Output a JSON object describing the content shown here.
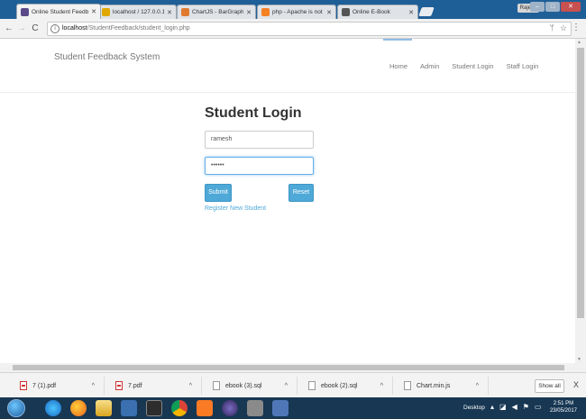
{
  "browser": {
    "tabs": [
      {
        "title": "Online Student Feedbac",
        "favicon_color": "#5b4a8a",
        "active": true
      },
      {
        "title": "localhost / 127.0.0.1 / fe",
        "favicon_color": "#e0a800",
        "active": false
      },
      {
        "title": "ChartJS - BarGraph",
        "favicon_color": "#e07a2e",
        "active": false
      },
      {
        "title": "php - Apache is not runn",
        "favicon_color": "#f48024",
        "active": false
      },
      {
        "title": "Online E-Book",
        "favicon_color": "#555555",
        "active": false
      }
    ],
    "user_badge": "Rajesh",
    "address": {
      "host": "localhost",
      "path": "/StudentFeedback/student_login.php"
    }
  },
  "site": {
    "brand": "Student Feedback System",
    "nav": [
      "Home",
      "Admin",
      "Student Login",
      "Staff Login"
    ]
  },
  "login": {
    "title": "Student Login",
    "username_value": "ramesh",
    "password_value": "••••••",
    "submit_label": "Submit",
    "reset_label": "Reset",
    "register_link": "Register New Student"
  },
  "downloads": {
    "items": [
      {
        "name": "7 (1).pdf",
        "type": "pdf"
      },
      {
        "name": "7.pdf",
        "type": "pdf"
      },
      {
        "name": "ebook (3).sql",
        "type": "file"
      },
      {
        "name": "ebook (2).sql",
        "type": "file"
      },
      {
        "name": "Chart.min.js",
        "type": "file"
      }
    ],
    "show_all": "Show all",
    "close": "X"
  },
  "taskbar": {
    "desktop_label": "Desktop",
    "time": "2:51 PM",
    "date": "23/05/2017"
  },
  "colors": {
    "accent": "#4ea9d8",
    "taskbar": "#173753",
    "tabstrip": "#1f5f98"
  }
}
